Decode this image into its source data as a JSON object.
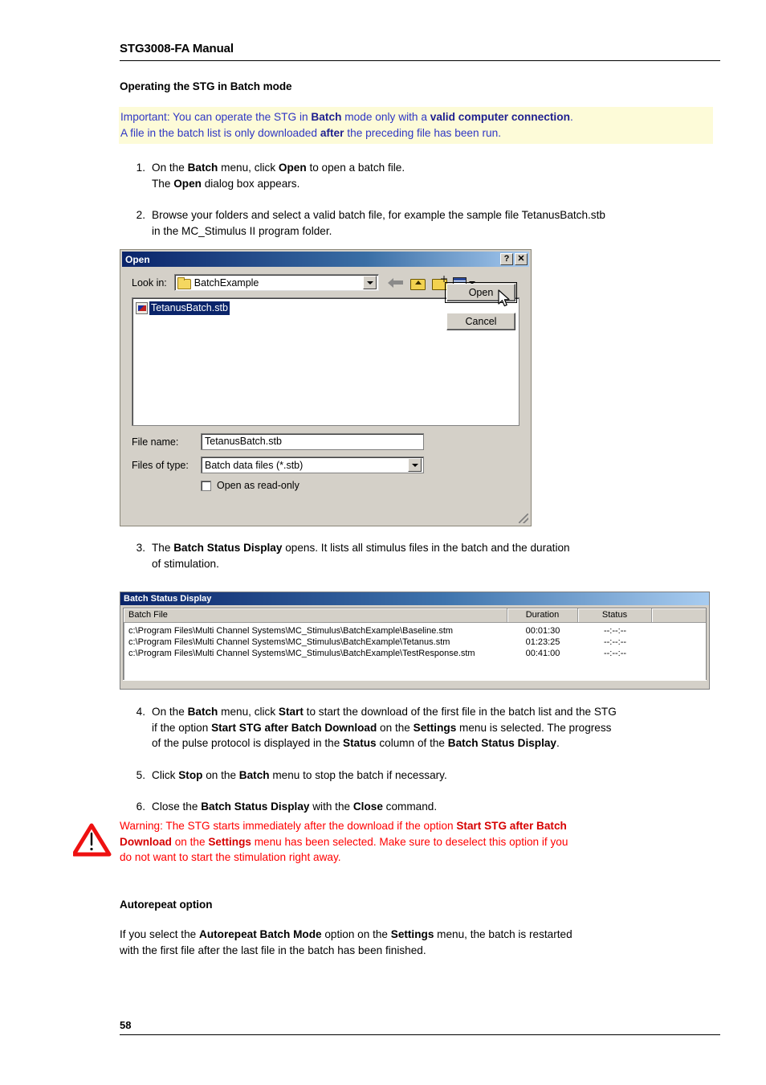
{
  "header": {
    "doc_title": "STG3008-FA Manual"
  },
  "section": {
    "heading": "Operating the STG in Batch mode"
  },
  "important_note": {
    "line1_a": "Important: You can operate the STG in ",
    "line1_b": "Batch",
    "line1_c": " mode only with a ",
    "line1_d": "valid computer connection",
    "line1_e": ".",
    "line2_a": "A file in the batch list is only downloaded ",
    "line2_b": "after",
    "line2_c": " the preceding file has been run.",
    "text_color": "#2f36c4",
    "background_color": "#fdfbd8"
  },
  "steps": [
    {
      "num": "1.",
      "p1_a": "On the ",
      "p1_b": "Batch",
      "p1_c": " menu, click ",
      "p1_d": "Open",
      "p1_e": " to open a batch file.",
      "p2_a": "The ",
      "p2_b": "Open",
      "p2_c": " dialog box appears."
    },
    {
      "num": "2.",
      "p1_a": "Browse your folders and select a valid batch file, for example the sample file TetanusBatch.stb",
      "p2_a": "in the MC_Stimulus II program folder."
    },
    {
      "num": "3.",
      "p1_a": "The ",
      "p1_b": "Batch Status Display",
      "p1_c": " opens. It lists all stimulus files in the batch and the duration",
      "p2_a": "of stimulation."
    },
    {
      "num": "4.",
      "l1_a": "On the ",
      "l1_b": "Batch",
      "l1_c": " menu, click ",
      "l1_d": "Start",
      "l1_e": " to start the download of the first file in the batch list and the STG",
      "l2_a": "if the option ",
      "l2_b": "Start STG after Batch Download",
      "l2_c": " on the ",
      "l2_d": "Settings",
      "l2_e": " menu is selected. The progress",
      "l3_a": "of the pulse protocol is displayed in the ",
      "l3_b": "Status",
      "l3_c": " column of the ",
      "l3_d": "Batch Status Display",
      "l3_e": "."
    },
    {
      "num": "5.",
      "p1_a": "Click ",
      "p1_b": "Stop",
      "p1_c": " on the ",
      "p1_d": "Batch",
      "p1_e": " menu to stop the batch if necessary."
    },
    {
      "num": "6.",
      "p1_a": "Close the ",
      "p1_b": "Batch Status Display",
      "p1_c": " with the ",
      "p1_d": "Close",
      "p1_e": " command."
    }
  ],
  "open_dialog": {
    "title": "Open",
    "help_button": "?",
    "close_button": "✕",
    "look_in_label": "Look in:",
    "look_in_value": "BatchExample",
    "toolbar_icons": [
      "back-arrow-icon",
      "up-one-level-icon",
      "new-folder-icon",
      "views-icon"
    ],
    "file_list": [
      {
        "name": "TetanusBatch.stb",
        "selected": true
      }
    ],
    "file_name_label": "File name:",
    "file_name_value": "TetanusBatch.stb",
    "files_of_type_label": "Files of type:",
    "files_of_type_value": "Batch data files (*.stb)",
    "open_button": "Open",
    "cancel_button": "Cancel",
    "read_only_label": "Open as read-only",
    "read_only_checked": false
  },
  "batch_status_display": {
    "title": "Batch Status Display",
    "columns": [
      "Batch File",
      "Duration",
      "Status"
    ],
    "rows": [
      {
        "file": "c:\\Program Files\\Multi Channel Systems\\MC_Stimulus\\BatchExample\\Baseline.stm",
        "duration": "00:01:30",
        "status": "--:--:--"
      },
      {
        "file": "c:\\Program Files\\Multi Channel Systems\\MC_Stimulus\\BatchExample\\Tetanus.stm",
        "duration": "01:23:25",
        "status": "--:--:--"
      },
      {
        "file": "c:\\Program Files\\Multi Channel Systems\\MC_Stimulus\\BatchExample\\TestResponse.stm",
        "duration": "00:41:00",
        "status": "--:--:--"
      }
    ]
  },
  "warning": {
    "icon": "warning-triangle-icon",
    "l1_a": "Warning: The STG starts immediately after the download if the option ",
    "l1_b": "Start STG after Batch",
    "l2_a": "Download",
    "l2_b": " on the ",
    "l2_c": "Settings",
    "l2_d": " menu has been selected. Make sure to deselect this option if you",
    "l3_a": "do not want to start the stimulation right away.",
    "color": "#ff0000"
  },
  "autorepeat": {
    "heading": "Autorepeat option",
    "l1_a": "If you select the ",
    "l1_b": "Autorepeat Batch Mode",
    "l1_c": " option on the ",
    "l1_d": "Settings",
    "l1_e": " menu, the batch is restarted",
    "l2_a": "with the first file after the last file in the batch has been finished."
  },
  "footer": {
    "page_number": "58"
  }
}
